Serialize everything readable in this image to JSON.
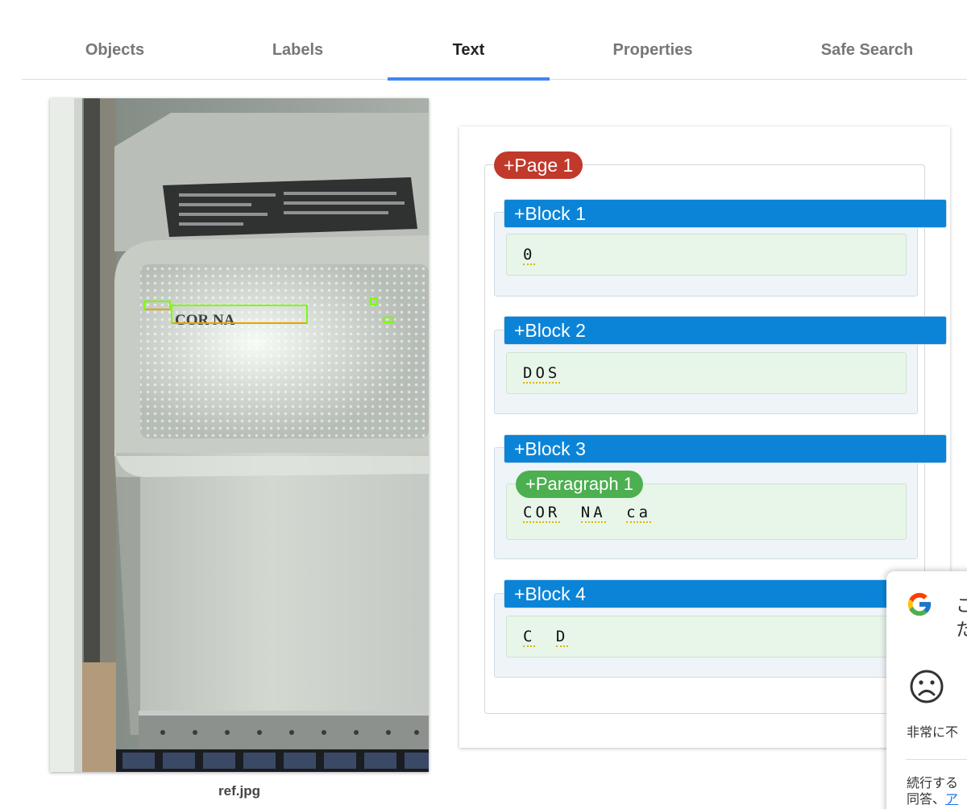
{
  "tabs": [
    {
      "label": "Objects",
      "active": false
    },
    {
      "label": "Labels",
      "active": false
    },
    {
      "label": "Text",
      "active": true
    },
    {
      "label": "Properties",
      "active": false
    },
    {
      "label": "Safe Search",
      "active": false
    }
  ],
  "image": {
    "caption": "ref.jpg",
    "logo_text": "COR NA"
  },
  "results": {
    "page_label": "+Page 1",
    "blocks": [
      {
        "label": "+Block 1",
        "words": [
          "0"
        ]
      },
      {
        "label": "+Block 2",
        "words": [
          "DOS"
        ]
      },
      {
        "label": "+Block 3",
        "paragraph_label": "+Paragraph 1",
        "words": [
          "COR",
          "NA",
          "ca"
        ]
      },
      {
        "label": "+Block 4",
        "words": [
          "C",
          "D"
        ]
      }
    ]
  },
  "feedback_popup": {
    "title_line1": "こ",
    "title_line2": "た",
    "rating_label": "非常に不",
    "footer_line1": "続行する",
    "footer_line2_text": "同答、",
    "footer_link": "ア"
  },
  "colors": {
    "tab_indicator": "#4285f4",
    "page_pill": "#c0392b",
    "block_pill": "#0b84d8",
    "paragraph_pill": "#4caf50"
  }
}
